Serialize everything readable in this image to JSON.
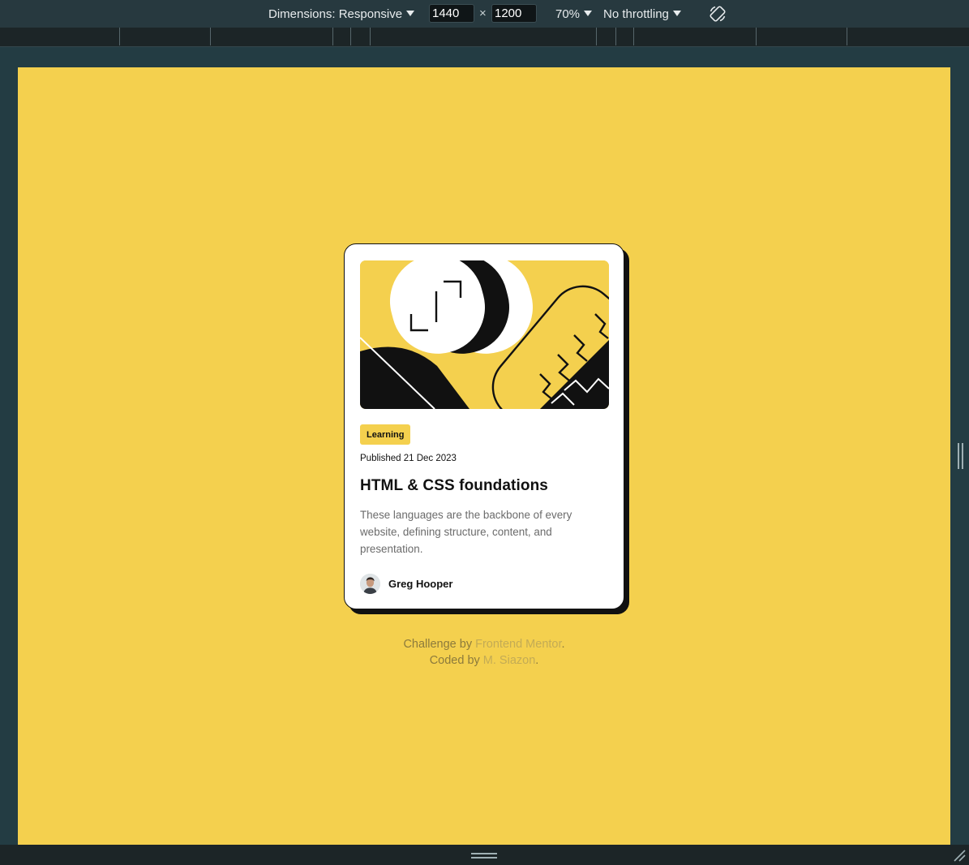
{
  "toolbar": {
    "dimensions_label": "Dimensions: Responsive",
    "width_value": "1440",
    "times": "×",
    "height_value": "1200",
    "zoom_label": "70%",
    "throttling_label": "No throttling"
  },
  "colors": {
    "page_background": "#f4d04e",
    "card_background": "#ffffff",
    "text_dark": "#111111",
    "text_muted": "#6b6b6b",
    "devtools_background": "#27393f"
  },
  "card": {
    "badge": "Learning",
    "published": "Published 21 Dec 2023",
    "title": "HTML & CSS foundations",
    "description": "These languages are the backbone of every website, defining structure, content, and presentation.",
    "author_name": "Greg Hooper"
  },
  "attribution": {
    "line1_prefix": "Challenge by ",
    "line1_link": "Frontend Mentor",
    "line1_suffix": ".",
    "line2_prefix": "Coded by ",
    "line2_link": "M. Siazon",
    "line2_suffix": "."
  }
}
